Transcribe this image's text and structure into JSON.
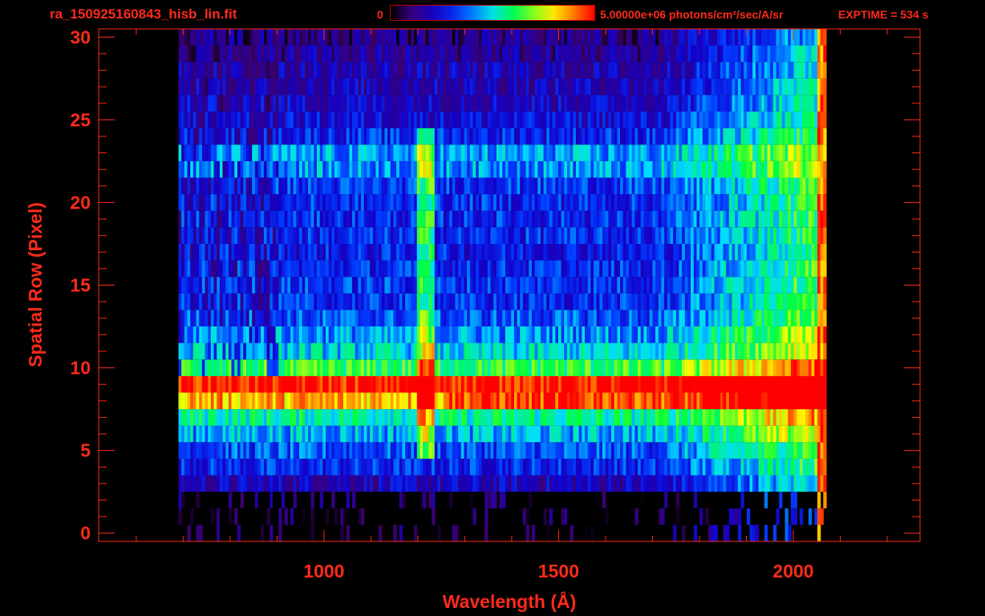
{
  "colors": {
    "axis": "#ff2a1a",
    "background": "#000000"
  },
  "header": {
    "filename": "ra_150925160843_hisb_lin.fit",
    "colorbar_min_label": "0",
    "colorbar_max_label": "5.00000e+06 photons/cm²/sec/A/sr",
    "exptime_label": "EXPTIME = 534 s"
  },
  "chart_data": {
    "type": "heatmap",
    "title": "ra_150925160843_hisb_lin.fit",
    "xlabel": "Wavelength (Å)",
    "ylabel": "Spatial Row (Pixel)",
    "xlim": [
      520,
      2270
    ],
    "ylim": [
      -0.5,
      30.5
    ],
    "x_ticks": [
      1000,
      1500,
      2000
    ],
    "y_ticks": [
      0,
      5,
      10,
      15,
      20,
      25,
      30
    ],
    "colorbar": {
      "min": 0,
      "max": 5000000,
      "units": "photons/cm²/sec/A/sr",
      "colormap": "rainbow"
    },
    "exptime_s": 534,
    "detector_x_range": [
      690,
      2070
    ],
    "row_intensity_profile": [
      {
        "row": 0,
        "level": 0.05
      },
      {
        "row": 1,
        "level": 0.05
      },
      {
        "row": 2,
        "level": 0.08
      },
      {
        "row": 3,
        "level": 0.2
      },
      {
        "row": 4,
        "level": 0.3
      },
      {
        "row": 5,
        "level": 0.35
      },
      {
        "row": 6,
        "level": 0.45
      },
      {
        "row": 7,
        "level": 0.55
      },
      {
        "row": 8,
        "level": 0.85
      },
      {
        "row": 9,
        "level": 1.0
      },
      {
        "row": 10,
        "level": 0.62
      },
      {
        "row": 11,
        "level": 0.48
      },
      {
        "row": 12,
        "level": 0.42
      },
      {
        "row": 13,
        "level": 0.35
      },
      {
        "row": 14,
        "level": 0.3
      },
      {
        "row": 15,
        "level": 0.32
      },
      {
        "row": 16,
        "level": 0.3
      },
      {
        "row": 17,
        "level": 0.28
      },
      {
        "row": 18,
        "level": 0.3
      },
      {
        "row": 19,
        "level": 0.3
      },
      {
        "row": 20,
        "level": 0.3
      },
      {
        "row": 21,
        "level": 0.32
      },
      {
        "row": 22,
        "level": 0.42
      },
      {
        "row": 23,
        "level": 0.42
      },
      {
        "row": 24,
        "level": 0.3
      },
      {
        "row": 25,
        "level": 0.25
      },
      {
        "row": 26,
        "level": 0.22
      },
      {
        "row": 27,
        "level": 0.2
      },
      {
        "row": 28,
        "level": 0.18
      },
      {
        "row": 29,
        "level": 0.15
      },
      {
        "row": 30,
        "level": 0.12
      }
    ],
    "features": [
      {
        "name": "Lyman-alpha",
        "wavelength": 1216,
        "rows": [
          5,
          24
        ]
      },
      {
        "name": "bright band",
        "wavelength_range": [
          950,
          2070
        ],
        "rows": [
          8,
          10
        ]
      },
      {
        "name": "long-wavelength edge",
        "wavelength": 2060,
        "rows": [
          0,
          30
        ]
      }
    ]
  }
}
